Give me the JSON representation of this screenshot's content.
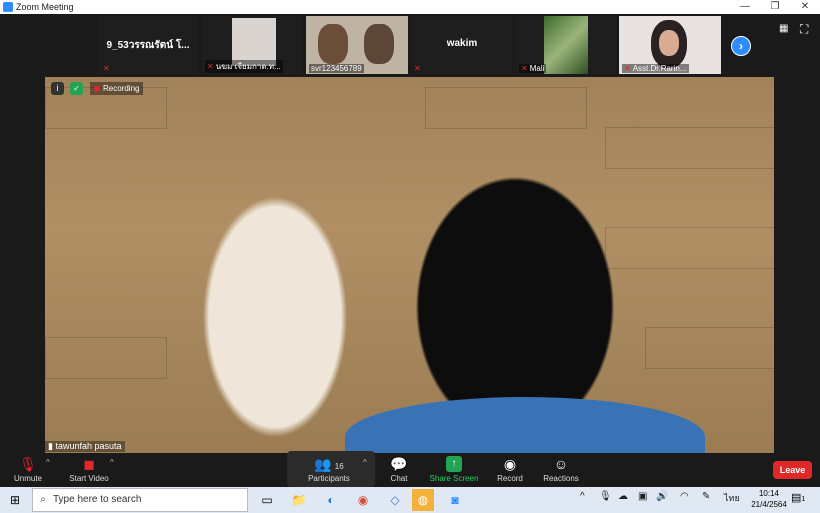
{
  "window": {
    "title": "Zoom Meeting",
    "controls": [
      "—",
      "❐",
      "✕"
    ]
  },
  "thumbnails": [
    {
      "name": "9_53วรรณรัตน์ โ...",
      "label": "",
      "muted": true
    },
    {
      "name": "",
      "label": "นฆม เจียมกาด.ท...",
      "muted": true
    },
    {
      "name": "",
      "label": "svr123456789",
      "muted": false
    },
    {
      "name": "wakim",
      "label": "",
      "muted": true
    },
    {
      "name": "",
      "label": "Mali",
      "muted": true
    },
    {
      "name": "",
      "label": "Asst.Dr.Rarin...",
      "muted": true
    }
  ],
  "video": {
    "speaker": "tawunfah pasuta",
    "recording_label": "Recording"
  },
  "toolbar": {
    "unmute": "Unmute",
    "start_video": "Start Video",
    "participants": "Participants",
    "participants_count": "16",
    "chat": "Chat",
    "share_screen": "Share Screen",
    "record": "Record",
    "reactions": "Reactions",
    "leave": "Leave"
  },
  "taskbar": {
    "search_placeholder": "Type here to search",
    "lang": "ไทย",
    "time": "10:14",
    "date": "21/4/2564",
    "notification_count": "1"
  },
  "colors": {
    "accent": "#2d8cff",
    "danger": "#e02828",
    "share": "#23a455"
  }
}
